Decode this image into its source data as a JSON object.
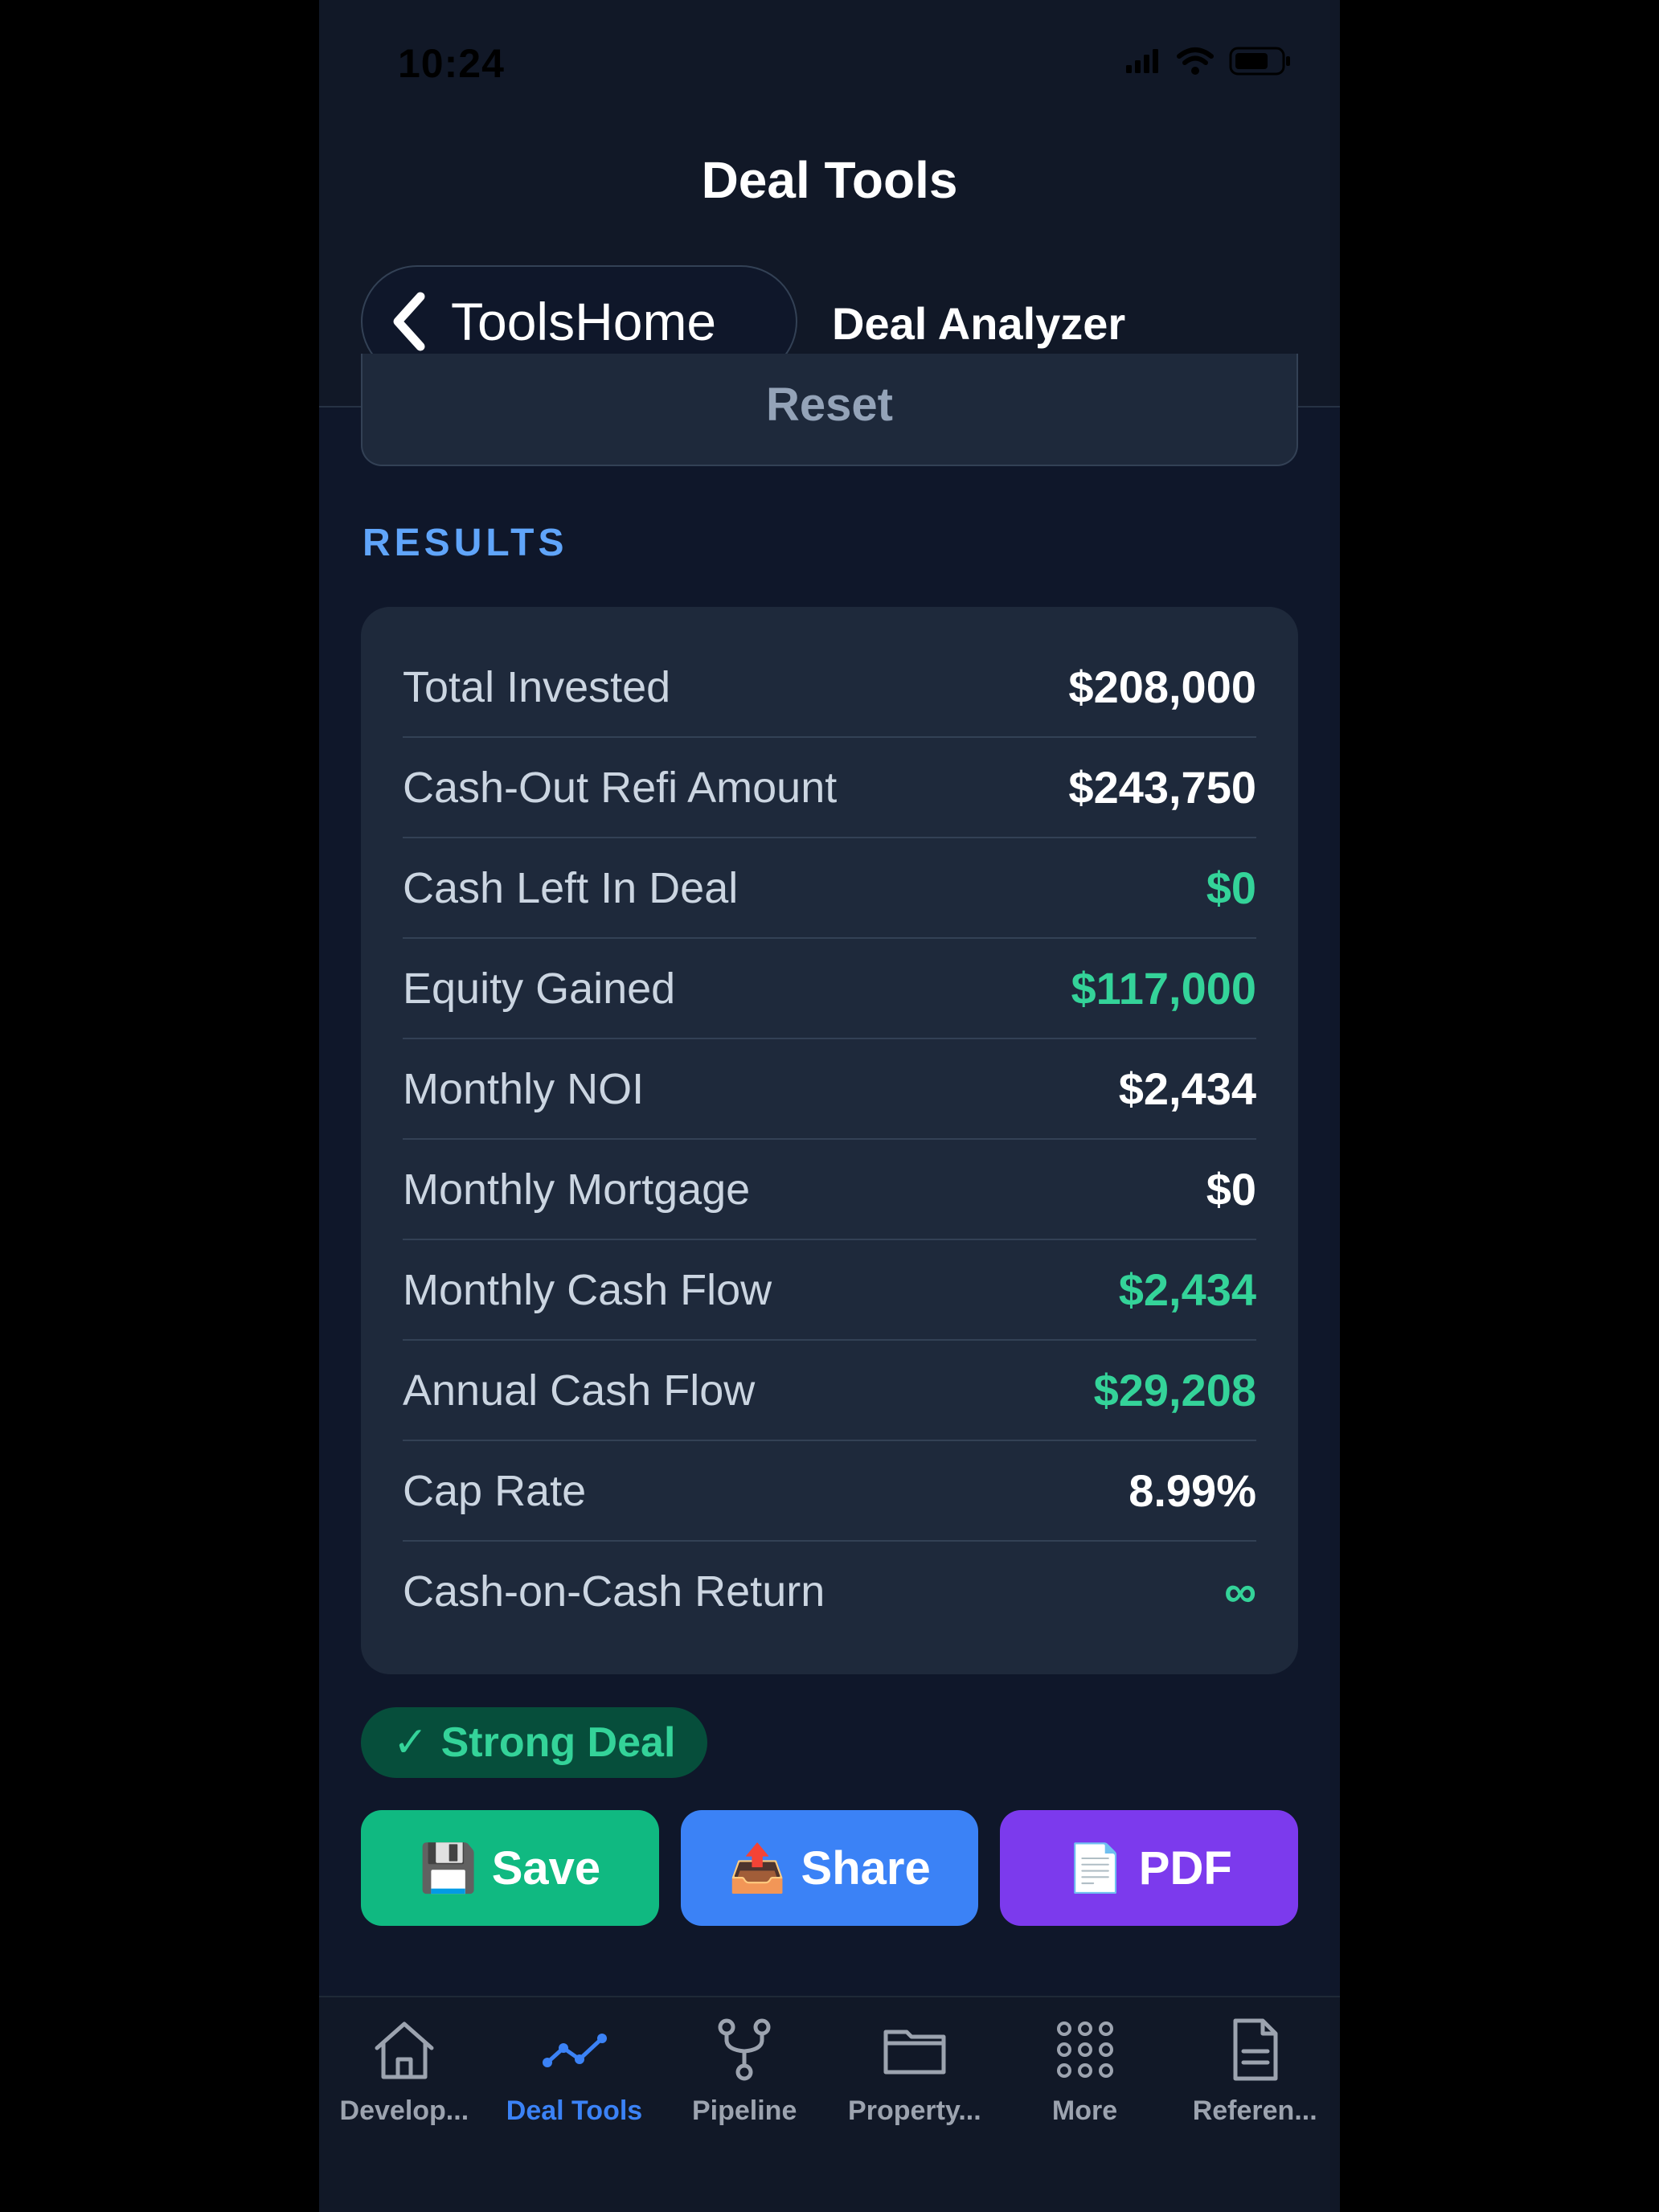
{
  "status_bar": {
    "time": "10:24"
  },
  "header": {
    "title": "Deal Tools"
  },
  "nav": {
    "back_label": "ToolsHome",
    "screen_title": "Deal Analyzer"
  },
  "reset": {
    "label": "Reset"
  },
  "results": {
    "section_label": "RESULTS",
    "rows": [
      {
        "label": "Total Invested",
        "value": "$208,000"
      },
      {
        "label": "Cash-Out Refi Amount",
        "value": "$243,750"
      },
      {
        "label": "Cash Left In Deal",
        "value": "$0"
      },
      {
        "label": "Equity Gained",
        "value": "$117,000"
      },
      {
        "label": "Monthly NOI",
        "value": "$2,434"
      },
      {
        "label": "Monthly Mortgage",
        "value": "$0"
      },
      {
        "label": "Monthly Cash Flow",
        "value": "$2,434"
      },
      {
        "label": "Annual Cash Flow",
        "value": "$29,208"
      },
      {
        "label": "Cap Rate",
        "value": "8.99%"
      },
      {
        "label": "Cash-on-Cash Return",
        "value": "∞"
      }
    ]
  },
  "badge": {
    "check": "✓",
    "label": "Strong Deal"
  },
  "actions": {
    "save": {
      "emoji": "💾",
      "label": "Save"
    },
    "share": {
      "emoji": "📤",
      "label": "Share"
    },
    "pdf": {
      "emoji": "📄",
      "label": "PDF"
    }
  },
  "tabs": [
    {
      "label": "Develop...",
      "icon": "house-icon"
    },
    {
      "label": "Deal Tools",
      "icon": "chart-line-icon",
      "active": true
    },
    {
      "label": "Pipeline",
      "icon": "git-fork-icon"
    },
    {
      "label": "Property...",
      "icon": "folder-icon"
    },
    {
      "label": "More",
      "icon": "grid-dots-icon"
    },
    {
      "label": "Referen...",
      "icon": "document-icon"
    }
  ],
  "colors": {
    "background": "#0f172a",
    "card": "#1e293b",
    "accent_blue": "#3b82f6",
    "positive_green": "#34d399",
    "save": "#10b981",
    "share": "#3b82f6",
    "pdf": "#7c3aed"
  }
}
